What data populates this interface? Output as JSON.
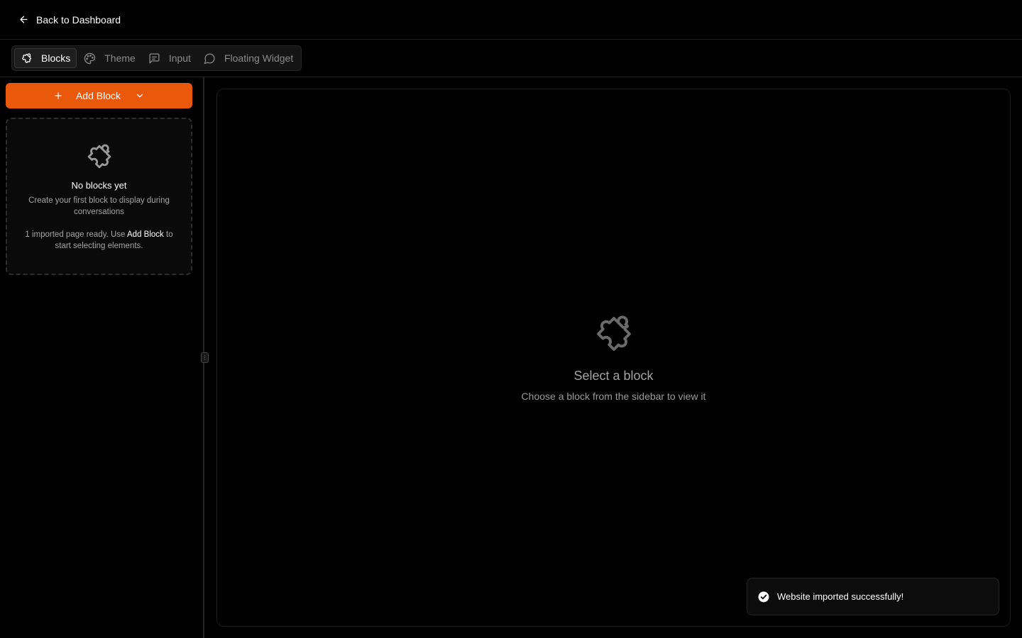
{
  "topbar": {
    "back_label": "Back to Dashboard"
  },
  "tabs": [
    {
      "label": "Blocks",
      "icon": "puzzle-icon",
      "active": true
    },
    {
      "label": "Theme",
      "icon": "palette-icon",
      "active": false
    },
    {
      "label": "Input",
      "icon": "message-square-icon",
      "active": false
    },
    {
      "label": "Floating Widget",
      "icon": "message-circle-icon",
      "active": false
    }
  ],
  "sidebar": {
    "add_block_label": "Add Block",
    "empty": {
      "title": "No blocks yet",
      "description": "Create your first block to display during conversations",
      "hint_prefix": "1 imported page ready. Use",
      "hint_emphasis": "Add Block",
      "hint_suffix": "to start selecting elements."
    }
  },
  "main": {
    "title": "Select a block",
    "description": "Choose a block from the sidebar to view it"
  },
  "toast": {
    "message": "Website imported successfully!"
  },
  "colors": {
    "accent": "#ea580c",
    "background": "#000000"
  }
}
